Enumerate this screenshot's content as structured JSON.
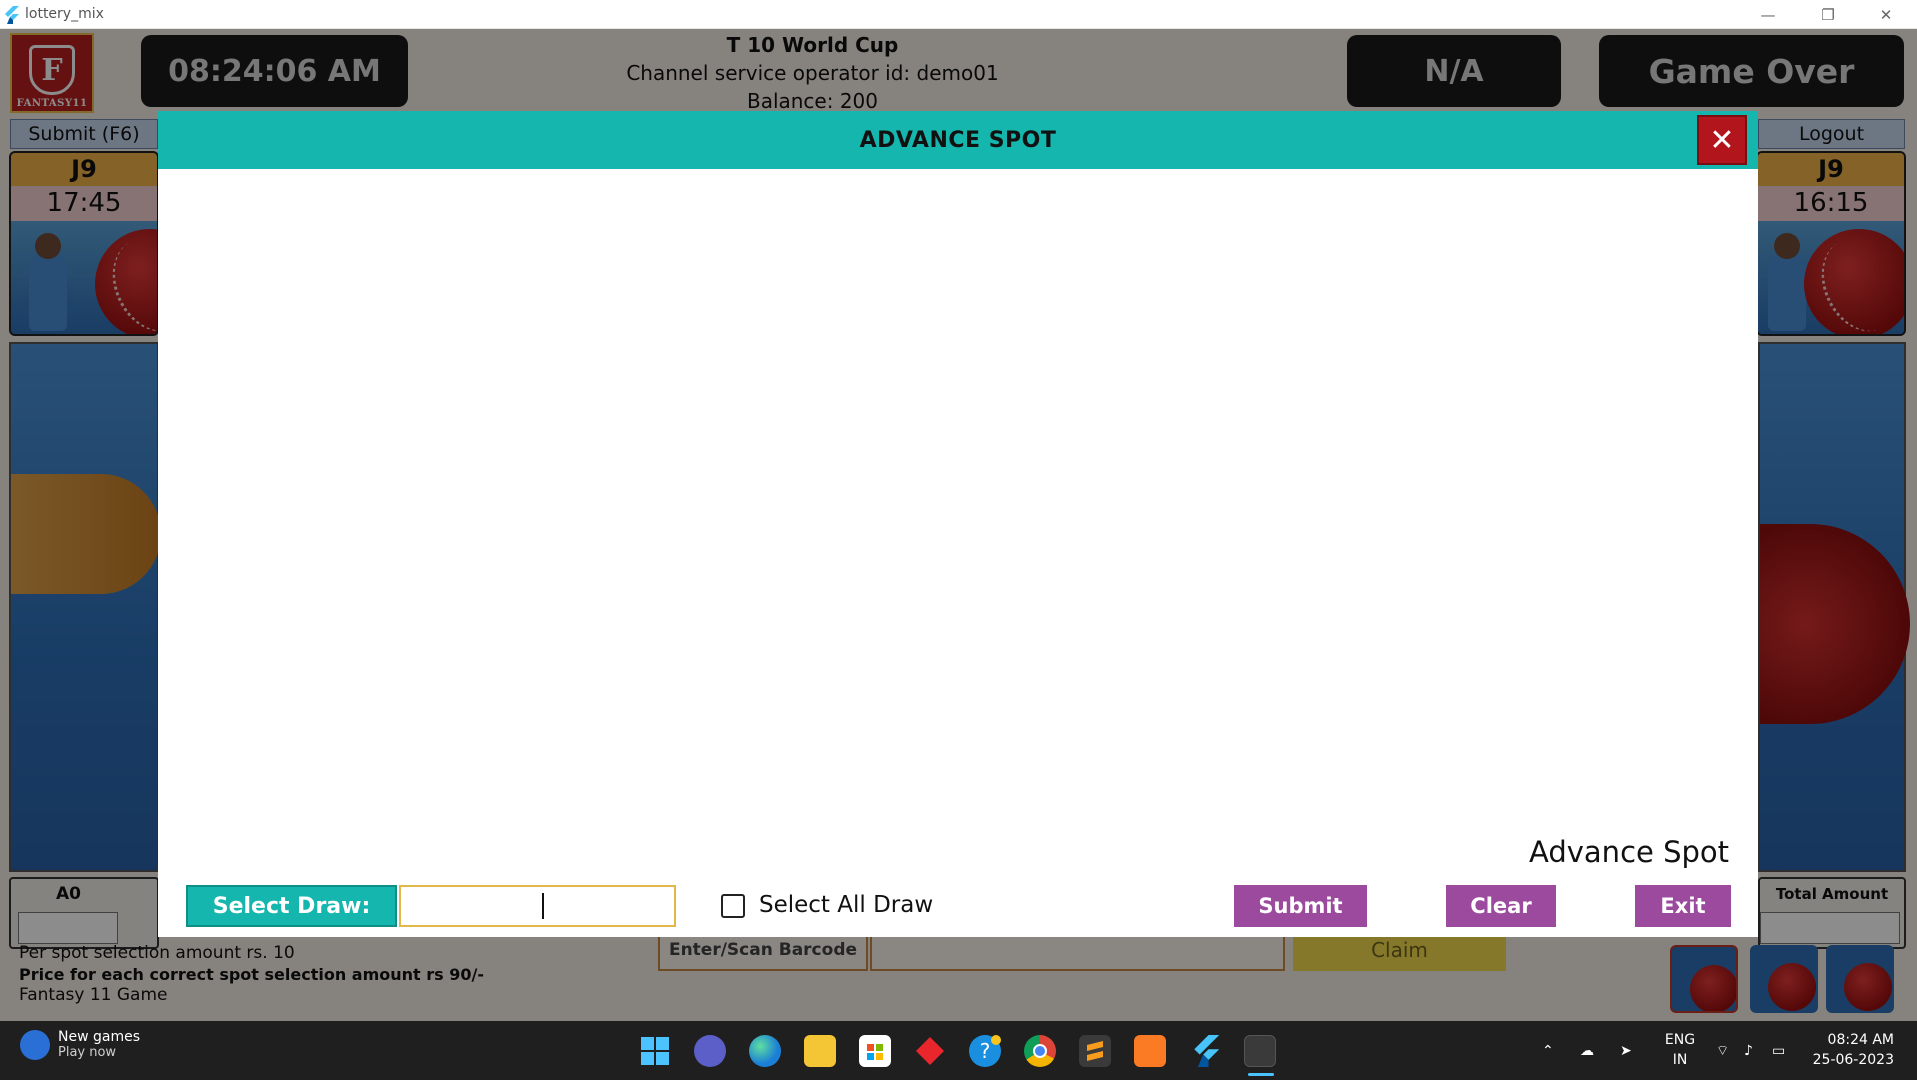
{
  "window": {
    "title": "lottery_mix",
    "minimize_glyph": "—",
    "restore_glyph": "❐",
    "close_glyph": "✕"
  },
  "header": {
    "logo_letter": "F",
    "logo_text": "FANTASY11",
    "time": "08:24:06 AM",
    "game_title": "T 10 World Cup",
    "operator": "Channel service operator id: demo01",
    "balance": "Balance: 200",
    "result": "N/A",
    "status": "Game Over"
  },
  "toolbar": {
    "submit_label": "Submit (F6)",
    "logout_label": "Logout"
  },
  "cards": {
    "left": {
      "code": "J9",
      "time": "17:45"
    },
    "right": {
      "code": "J9",
      "time": "16:15"
    }
  },
  "bottom": {
    "left_header": "A0",
    "right_header": "Total Amount",
    "info_line1": "Per spot selection amount rs. 10",
    "info_line2": "Price for each correct spot selection amount rs 90/-",
    "info_line3": "Fantasy 11 Game",
    "barcode_label": "Enter/Scan Barcode",
    "barcode_value": "",
    "claim_label": "Claim"
  },
  "dialog": {
    "title": "ADVANCE SPOT",
    "close_glyph": "✕",
    "section_label": "Advance Spot",
    "select_draw_label": "Select Draw:",
    "select_draw_value": "",
    "select_all_label": "Select All Draw",
    "select_all_checked": false,
    "submit_label": "Submit",
    "clear_label": "Clear",
    "exit_label": "Exit"
  },
  "taskbar": {
    "news_title": "New games",
    "news_subtitle": "Play now",
    "apps": [
      "windows-start-icon",
      "teams-chat-icon",
      "edge-icon",
      "file-explorer-icon",
      "store-icon",
      "app-diamond-icon",
      "help-icon",
      "chrome-icon",
      "sublime-text-icon",
      "xampp-icon",
      "flutter-icon",
      "snipping-tool-icon"
    ],
    "lang_line1": "ENG",
    "lang_line2": "IN",
    "time": "08:24 AM",
    "date": "25-06-2023"
  },
  "colors": {
    "teal": "#14b6ad",
    "purple_button": "#9b4a9e",
    "close_red": "#b3151c",
    "claim_yellow": "#f2da4d"
  }
}
